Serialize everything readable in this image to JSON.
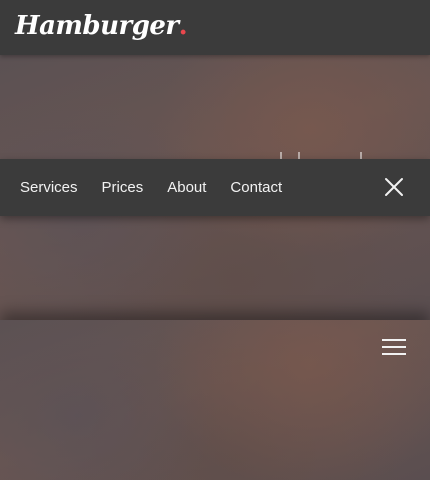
{
  "brand": {
    "logo_text": "Hamburger",
    "logo_dot": ".",
    "accent_color": "#e9474d"
  },
  "nav": {
    "items": [
      {
        "label": "Services"
      },
      {
        "label": "Prices"
      },
      {
        "label": "About"
      },
      {
        "label": "Contact"
      }
    ],
    "close_icon": "close-icon",
    "background": "#3b3b3b"
  },
  "hero_sections": [
    {
      "heading": "",
      "blurred": true
    },
    {
      "heading": "",
      "blurred": true,
      "menu_icon": "hamburger-menu-icon"
    }
  ],
  "colors": {
    "bar_background": "#3b3b3b",
    "text": "#f2f2f2"
  }
}
